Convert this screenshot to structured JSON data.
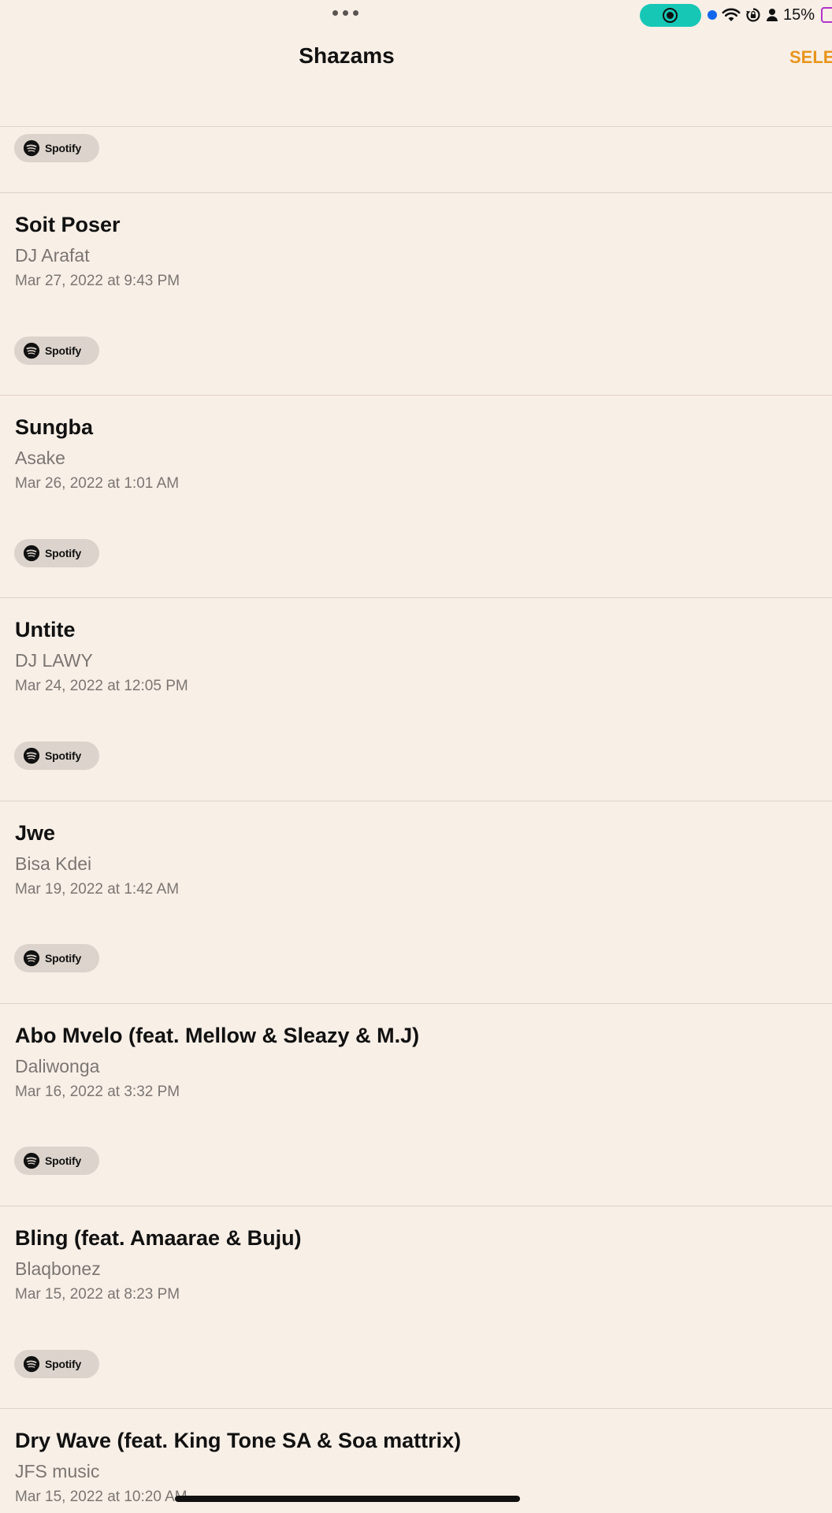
{
  "status_bar": {
    "battery_text": "15%"
  },
  "nav": {
    "title": "Shazams",
    "select_label": "SELE"
  },
  "spotify_label": "Spotify",
  "top_row": {
    "service": "Spotify"
  },
  "songs": [
    {
      "title": "Soit Poser",
      "artist": "DJ Arafat",
      "date": "Mar 27, 2022 at 9:43 PM",
      "service": "Spotify"
    },
    {
      "title": "Sungba",
      "artist": "Asake",
      "date": "Mar 26, 2022 at 1:01 AM",
      "service": "Spotify"
    },
    {
      "title": "Untite",
      "artist": "DJ LAWY",
      "date": "Mar 24, 2022 at 12:05 PM",
      "service": "Spotify"
    },
    {
      "title": "Jwe",
      "artist": "Bisa Kdei",
      "date": "Mar 19, 2022 at 1:42 AM",
      "service": "Spotify"
    },
    {
      "title": "Abo Mvelo (feat. Mellow & Sleazy & M.J)",
      "artist": "Daliwonga",
      "date": "Mar 16, 2022 at 3:32 PM",
      "service": "Spotify"
    },
    {
      "title": "Bling (feat. Amaarae & Buju)",
      "artist": "Blaqbonez",
      "date": "Mar 15, 2022 at 8:23 PM",
      "service": "Spotify"
    },
    {
      "title": "Dry Wave (feat. King Tone SA & Soa mattrix)",
      "artist": "JFS music",
      "date": "Mar 15, 2022 at 10:20 AM"
    }
  ]
}
